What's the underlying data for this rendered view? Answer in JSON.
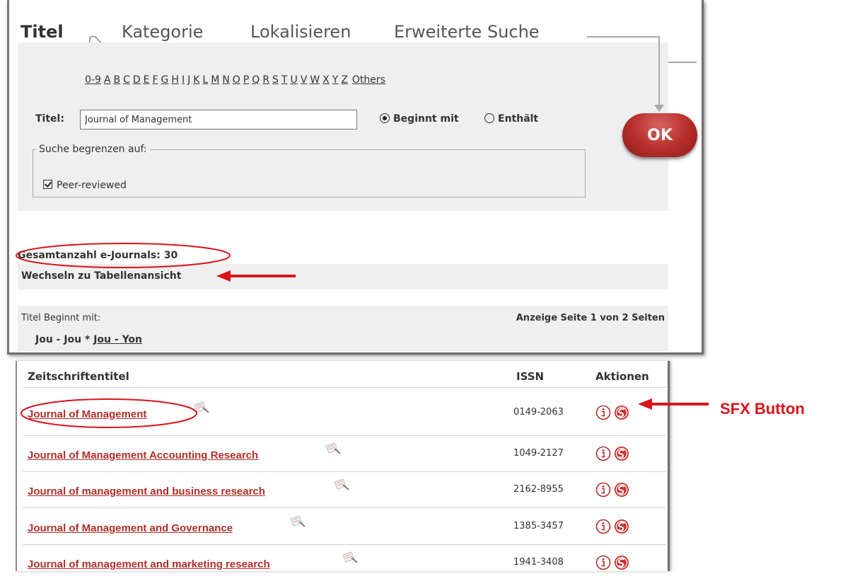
{
  "tabs": [
    {
      "label": "Titel",
      "active": true
    },
    {
      "label": "Kategorie",
      "active": false
    },
    {
      "label": "Lokalisieren",
      "active": false
    },
    {
      "label": "Erweiterte Suche",
      "active": false
    }
  ],
  "alphabet": [
    "0-9",
    "A",
    "B",
    "C",
    "D",
    "E",
    "F",
    "G",
    "H",
    "I",
    "J",
    "K",
    "L",
    "M",
    "N",
    "O",
    "P",
    "Q",
    "R",
    "S",
    "T",
    "U",
    "V",
    "W",
    "X",
    "Y",
    "Z"
  ],
  "alphabet_others": "Others",
  "search": {
    "titel_label": "Titel:",
    "titel_value": "Journal of Management",
    "radio_beginnt": "Beginnt mit",
    "radio_enthaelt": "Enthält",
    "selected": "beginnt",
    "ok_label": "OK"
  },
  "limit": {
    "legend": "Suche begrenzen auf:",
    "peer_reviewed": "Peer-reviewed",
    "peer_checked": true
  },
  "summary": {
    "total": "Gesamtanzahl e-Journals: 30",
    "switch_view": "Wechseln zu Tabellenansicht",
    "prefix_label": "Titel Beginnt mit:",
    "range_current": "Jou - Jou *",
    "range_next": "Jou - Yon",
    "page_info": "Anzeige Seite 1 von 2 Seiten"
  },
  "results": {
    "headers": {
      "title": "Zeitschriftentitel",
      "issn": "ISSN",
      "actions": "Aktionen"
    },
    "rows": [
      {
        "title": "Journal of Management",
        "issn": "0149-2063"
      },
      {
        "title": "Journal of Management Accounting Research",
        "issn": "1049-2127"
      },
      {
        "title": "Journal of management and business research",
        "issn": "2162-8955"
      },
      {
        "title": "Journal of Management and Governance",
        "issn": "1385-3457"
      },
      {
        "title": "Journal of management and marketing research",
        "issn": "1941-3408"
      }
    ]
  },
  "annotation": {
    "sfx_label": "SFX Button",
    "color": "#d9141a"
  },
  "colors": {
    "link": "#b12f2a",
    "panel": "#efefef",
    "ok_button": "#b52d2a"
  },
  "icons": [
    "peer-review-icon",
    "info-icon",
    "sfx-icon"
  ]
}
